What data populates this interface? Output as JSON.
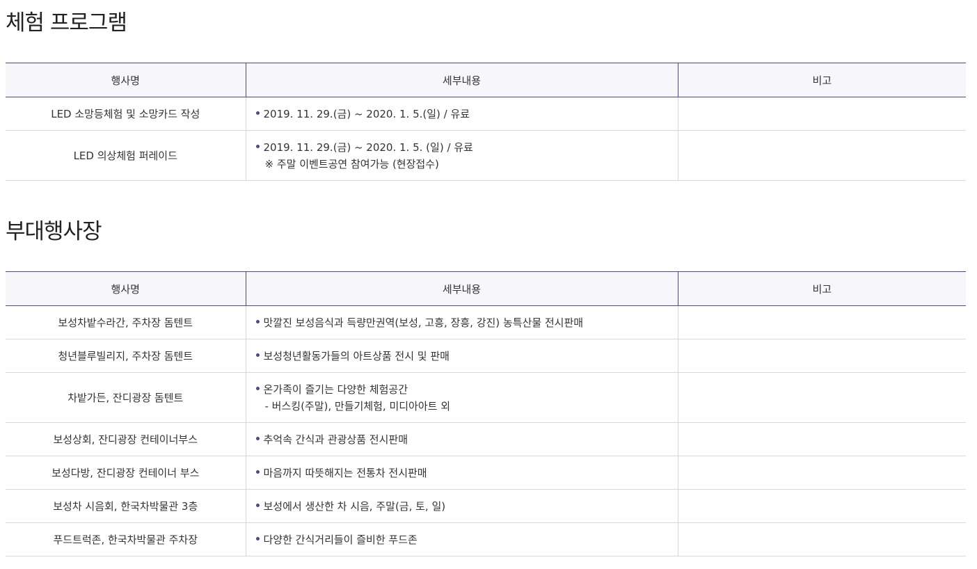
{
  "sections": [
    {
      "title": "체험 프로그램",
      "headers": [
        "행사명",
        "세부내용",
        "비고"
      ],
      "rows": [
        {
          "name": "LED 소망등체험 및 소망카드 작성",
          "detail": [
            "2019. 11. 29.(금) ~ 2020. 1. 5.(일) / 유료"
          ],
          "note": ""
        },
        {
          "name": "LED 의상체험 퍼레이드",
          "detail": [
            "2019. 11. 29.(금) ~ 2020. 1. 5. (일) / 유료",
            "※ 주말 이벤트공연 참여가능 (현장접수)"
          ],
          "note": ""
        }
      ]
    },
    {
      "title": "부대행사장",
      "headers": [
        "행사명",
        "세부내용",
        "비고"
      ],
      "rows": [
        {
          "name": "보성차밭수라간, 주차장 돔텐트",
          "detail": [
            "맛깔진 보성음식과 득량만권역(보성, 고흥, 장흥, 강진) 농특산물 전시판매"
          ],
          "note": ""
        },
        {
          "name": "청년블루빌리지, 주차장 돔텐트",
          "detail": [
            "보성청년활동가들의 아트상품 전시 및 판매"
          ],
          "note": ""
        },
        {
          "name": "차밭가든, 잔디광장 돔텐트",
          "detail": [
            "온가족이 즐기는 다양한 체험공간",
            "- 버스킹(주말), 만들기체험, 미디아아트 외"
          ],
          "note": ""
        },
        {
          "name": "보성상회, 잔디광장 컨테이너부스",
          "detail": [
            "추억속 간식과 관광상품 전시판매"
          ],
          "note": ""
        },
        {
          "name": "보성다방, 잔디광장 컨테이너 부스",
          "detail": [
            "마음까지 따뜻해지는 전통차 전시판매"
          ],
          "note": ""
        },
        {
          "name": "보성차 시음회, 한국차박물관 3층",
          "detail": [
            "보성에서 생산한 차 시음, 주말(금, 토, 일)"
          ],
          "note": ""
        },
        {
          "name": "푸드트럭존, 한국차박물관 주차장",
          "detail": [
            "다양한 간식거리들이 즐비한 푸드존"
          ],
          "note": ""
        }
      ]
    }
  ],
  "colors": {
    "header_border": "#4a4a7c",
    "header_bg": "#f6f6fb",
    "row_border": "#d8d8d8",
    "bullet": "#4a4a7c"
  }
}
